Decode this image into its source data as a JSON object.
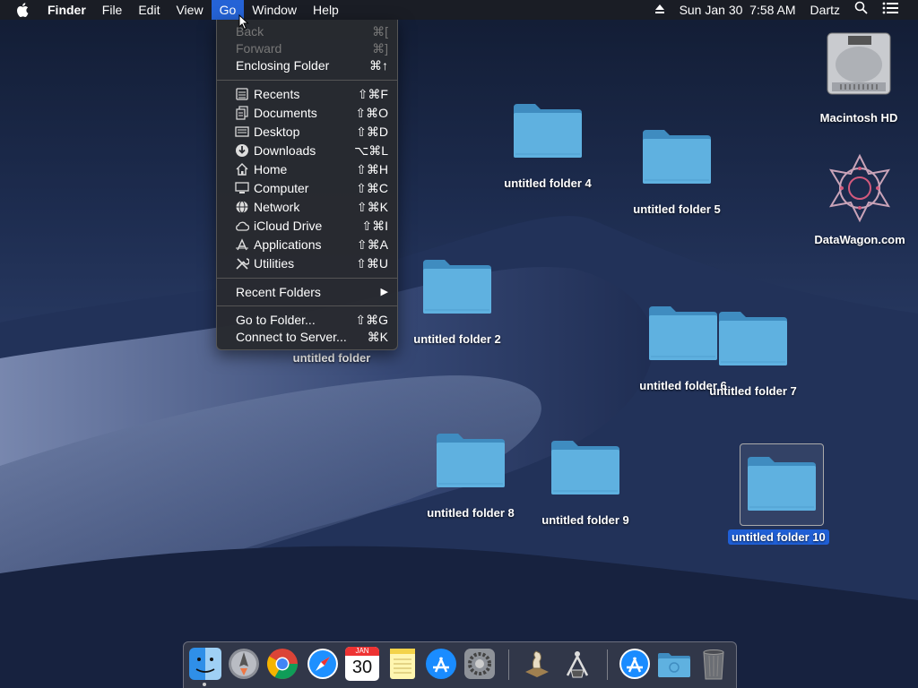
{
  "menubar": {
    "app_name": "Finder",
    "menus": [
      "File",
      "Edit",
      "View",
      "Go",
      "Window",
      "Help"
    ],
    "clock": "Sun Jan 30  7:58 AM",
    "user": "Dartz"
  },
  "go_menu": {
    "back": {
      "label": "Back",
      "shortcut": "⌘["
    },
    "forward": {
      "label": "Forward",
      "shortcut": "⌘]"
    },
    "enclosing": {
      "label": "Enclosing Folder",
      "shortcut": "⌘↑"
    },
    "places": [
      {
        "label": "Recents",
        "shortcut": "⇧⌘F",
        "icon": "recents-icon"
      },
      {
        "label": "Documents",
        "shortcut": "⇧⌘O",
        "icon": "documents-icon"
      },
      {
        "label": "Desktop",
        "shortcut": "⇧⌘D",
        "icon": "desktop-icon"
      },
      {
        "label": "Downloads",
        "shortcut": "⌥⌘L",
        "icon": "downloads-icon"
      },
      {
        "label": "Home",
        "shortcut": "⇧⌘H",
        "icon": "home-icon"
      },
      {
        "label": "Computer",
        "shortcut": "⇧⌘C",
        "icon": "computer-icon"
      },
      {
        "label": "Network",
        "shortcut": "⇧⌘K",
        "icon": "network-icon"
      },
      {
        "label": "iCloud Drive",
        "shortcut": "⇧⌘I",
        "icon": "icloud-icon"
      },
      {
        "label": "Applications",
        "shortcut": "⇧⌘A",
        "icon": "applications-icon"
      },
      {
        "label": "Utilities",
        "shortcut": "⇧⌘U",
        "icon": "utilities-icon"
      }
    ],
    "recent_folders": {
      "label": "Recent Folders",
      "arrow": "▶"
    },
    "goto_folder": {
      "label": "Go to Folder...",
      "shortcut": "⇧⌘G"
    },
    "connect_server": {
      "label": "Connect to Server...",
      "shortcut": "⌘K"
    }
  },
  "desktop": {
    "drives": {
      "mac_hd": "Macintosh HD",
      "datawagon": "DataWagon.com"
    },
    "folders": {
      "f1": "untitled folder",
      "f2": "untitled folder 2",
      "f4": "untitled folder 4",
      "f5": "untitled folder 5",
      "f6": "untitled folder 6",
      "f7": "untitled folder 7",
      "f8": "untitled folder 8",
      "f9": "untitled folder 9",
      "f10": "untitled folder 10"
    }
  },
  "dock": {
    "calendar_month": "JAN",
    "calendar_day": "30",
    "apps": [
      "finder-icon",
      "launchpad-icon",
      "chrome-icon",
      "safari-icon",
      "calendar-icon",
      "notes-icon",
      "app-store-icon",
      "system-preferences-icon",
      "chess-icon",
      "directory-utility-icon",
      "app-store-downloads-icon",
      "folder-stack-icon",
      "trash-icon"
    ]
  },
  "colors": {
    "accent": "#2563d6",
    "folder": "#5fb1e0",
    "folder_dark": "#3f8cc0"
  }
}
